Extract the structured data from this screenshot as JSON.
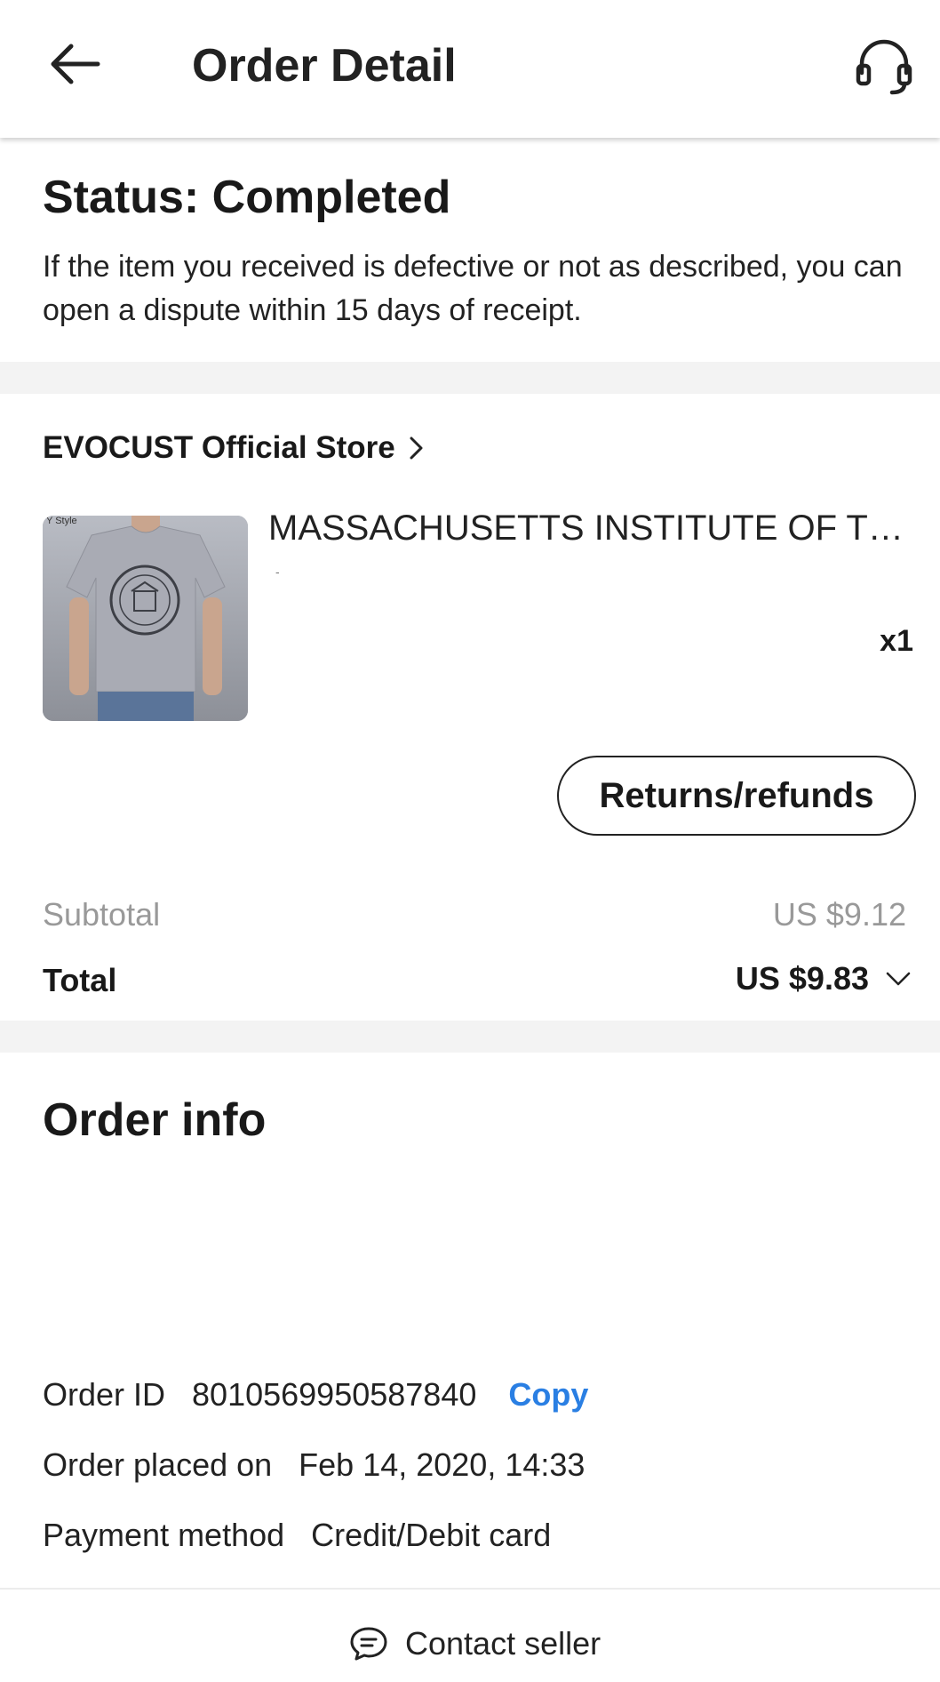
{
  "header": {
    "title": "Order Detail"
  },
  "status": {
    "title": "Status: Completed",
    "description": "If the item you received is defective or not as described, you can open a dispute within 15 days of receipt."
  },
  "store": {
    "name": "EVOCUST Official Store"
  },
  "product": {
    "title": "MASSACHUSETTS INSTITUTE OF TECHNOLOGY",
    "subtitle": "-",
    "quantity": "x1",
    "image_tag": "Y Style",
    "refund_label": "Returns/refunds"
  },
  "totals": {
    "subtotal_label": "Subtotal",
    "subtotal_value": "US $9.12",
    "total_label": "Total",
    "total_value": "US $9.83"
  },
  "order_info": {
    "title": "Order info",
    "order_id_label": "Order ID",
    "order_id_value": "8010569950587840",
    "copy_label": "Copy",
    "placed_label": "Order placed on",
    "placed_value": "Feb 14, 2020, 14:33",
    "payment_label": "Payment method",
    "payment_value": "Credit/Debit card"
  },
  "footer": {
    "contact_label": "Contact seller"
  },
  "icons": {
    "back": "arrow-left-icon",
    "support": "headset-icon",
    "store_chevron": "chevron-right-icon",
    "total_chevron": "chevron-down-icon",
    "contact": "chat-bubble-icon"
  },
  "colors": {
    "accent": "#2a7fe3",
    "muted": "#999999",
    "section_gap": "#f3f3f3"
  }
}
